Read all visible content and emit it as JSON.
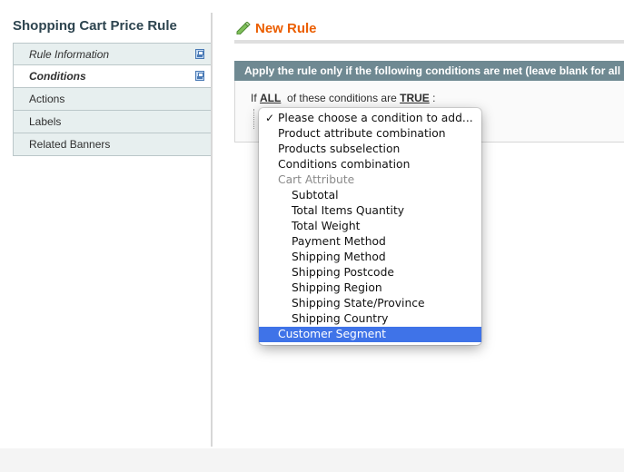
{
  "sidebar": {
    "title": "Shopping Cart Price Rule",
    "tabs": [
      {
        "label": "Rule Information",
        "style": "italic",
        "has_icon": true
      },
      {
        "label": "Conditions",
        "style": "active",
        "has_icon": true
      },
      {
        "label": "Actions",
        "style": "normal",
        "has_icon": false
      },
      {
        "label": "Labels",
        "style": "normal",
        "has_icon": false
      },
      {
        "label": "Related Banners",
        "style": "normal",
        "has_icon": false
      }
    ]
  },
  "main": {
    "title": "New Rule",
    "fieldset_title": "Apply the rule only if the following conditions are met (leave blank for all",
    "condition": {
      "prefix": "If",
      "aggregator": "ALL",
      "middle": "of these conditions are",
      "value": "TRUE",
      "suffix": ":"
    }
  },
  "dropdown": {
    "options": [
      {
        "label": "Please choose a condition to add...",
        "selected": true,
        "indent": false,
        "group": false
      },
      {
        "label": "Product attribute combination",
        "indent": false,
        "group": false
      },
      {
        "label": "Products subselection",
        "indent": false,
        "group": false
      },
      {
        "label": "Conditions combination",
        "indent": false,
        "group": false
      },
      {
        "label": "Cart Attribute",
        "indent": false,
        "group": true
      },
      {
        "label": "Subtotal",
        "indent": true,
        "group": false
      },
      {
        "label": "Total Items Quantity",
        "indent": true,
        "group": false
      },
      {
        "label": "Total Weight",
        "indent": true,
        "group": false
      },
      {
        "label": "Payment Method",
        "indent": true,
        "group": false
      },
      {
        "label": "Shipping Method",
        "indent": true,
        "group": false
      },
      {
        "label": "Shipping Postcode",
        "indent": true,
        "group": false
      },
      {
        "label": "Shipping Region",
        "indent": true,
        "group": false
      },
      {
        "label": "Shipping State/Province",
        "indent": true,
        "group": false
      },
      {
        "label": "Shipping Country",
        "indent": true,
        "group": false
      },
      {
        "label": "Customer Segment",
        "indent": false,
        "group": false,
        "highlighted": true
      }
    ],
    "check_glyph": "✓"
  },
  "icons": {
    "tab_icon": "save-icon",
    "title_icon": "pencil-icon"
  },
  "colors": {
    "accent_orange": "#eb5e00",
    "fieldset_header": "#6f8992",
    "tab_background": "#e7efef",
    "highlight": "#3f73e8"
  }
}
